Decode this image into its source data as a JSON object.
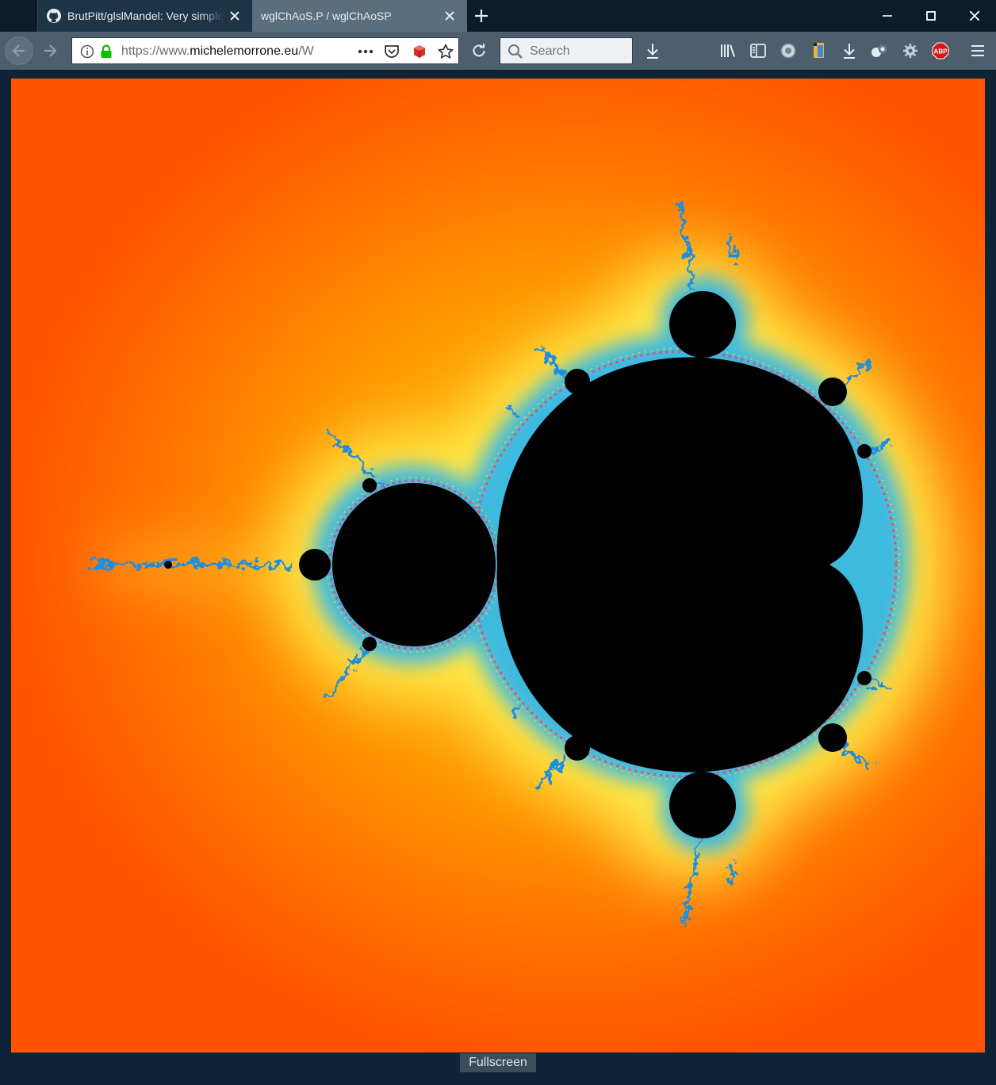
{
  "browser": {
    "tabs": [
      {
        "title": "BrutPitt/glslMandel: Very simple",
        "favicon": "github-icon",
        "active": false
      },
      {
        "title": "wglChAoS.P / wglChAoSP",
        "favicon": "none",
        "active": true
      }
    ],
    "url": {
      "scheme": "https://www.",
      "domain": "michelemorrone.eu",
      "path": "/W"
    },
    "search_placeholder": "Search",
    "toolbar_icons": [
      "info-icon",
      "lock-icon",
      "page-actions-icon",
      "pocket-icon",
      "extension-icon",
      "bookmark-star-icon",
      "reload-icon",
      "download-icon",
      "library-icon",
      "sidebar-icon",
      "extension-icon",
      "extension-icon",
      "download-icon",
      "extension-icon",
      "gear-icon",
      "adblock-icon",
      "menu-icon"
    ],
    "adblock_badge": "ABP"
  },
  "page": {
    "fullscreen_label": "Fullscreen"
  },
  "colors": {
    "set_interior": "#000000",
    "near_boundary": "#1ea7f5",
    "glow": "#ffe600",
    "far_background": "#ff5300"
  }
}
